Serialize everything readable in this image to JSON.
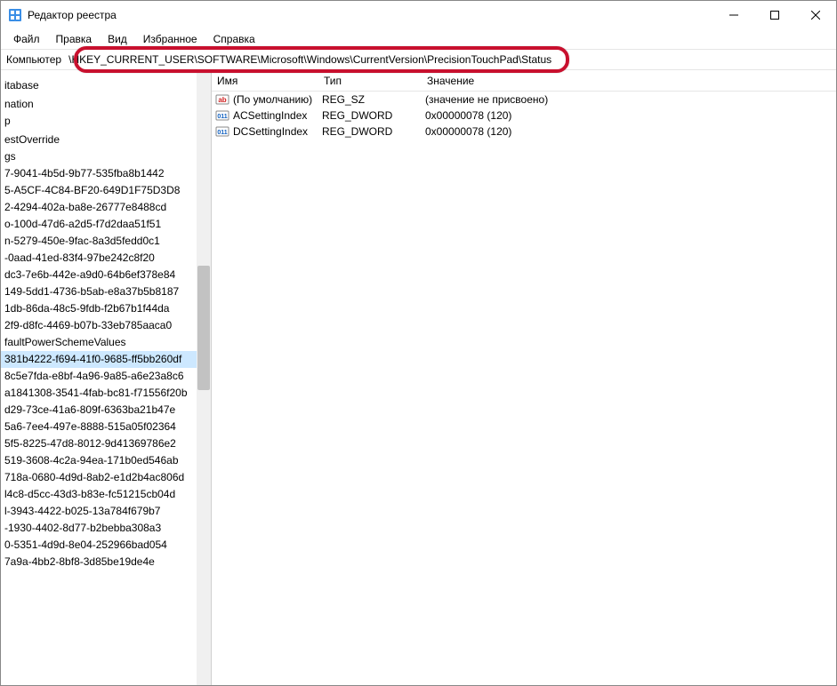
{
  "window": {
    "title": "Редактор реестра"
  },
  "menu": {
    "file": "Файл",
    "edit": "Правка",
    "view": "Вид",
    "favorites": "Избранное",
    "help": "Справка"
  },
  "addressbar": {
    "label": "Компьютер",
    "path": "\\HKEY_CURRENT_USER\\SOFTWARE\\Microsoft\\Windows\\CurrentVersion\\PrecisionTouchPad\\Status"
  },
  "tree": {
    "items": [
      "",
      "",
      "itabase",
      "",
      "nation",
      "p",
      "",
      "estOverride",
      "gs",
      "7-9041-4b5d-9b77-535fba8b1442",
      "5-A5CF-4C84-BF20-649D1F75D3D8",
      "2-4294-402a-ba8e-26777e8488cd",
      "o-100d-47d6-a2d5-f7d2daa51f51",
      "n-5279-450e-9fac-8a3d5fedd0c1",
      "-0aad-41ed-83f4-97be242c8f20",
      "dc3-7e6b-442e-a9d0-64b6ef378e84",
      "149-5dd1-4736-b5ab-e8a37b5b8187",
      "1db-86da-48c5-9fdb-f2b67b1f44da",
      "2f9-d8fc-4469-b07b-33eb785aaca0",
      "faultPowerSchemeValues",
      "381b4222-f694-41f0-9685-ff5bb260df",
      "8c5e7fda-e8bf-4a96-9a85-a6e23a8c6",
      "a1841308-3541-4fab-bc81-f71556f20b",
      "d29-73ce-41a6-809f-6363ba21b47e",
      "5a6-7ee4-497e-8888-515a05f02364",
      "5f5-8225-47d8-8012-9d41369786e2",
      "519-3608-4c2a-94ea-171b0ed546ab",
      "718a-0680-4d9d-8ab2-e1d2b4ac806d",
      "l4c8-d5cc-43d3-b83e-fc51215cb04d",
      "l-3943-4422-b025-13a784f679b7",
      "-1930-4402-8d77-b2bebba308a3",
      "0-5351-4d9d-8e04-252966bad054",
      "7a9a-4bb2-8bf8-3d85be19de4e"
    ],
    "selected_index": 20
  },
  "columns": {
    "name": "Имя",
    "type": "Тип",
    "value": "Значение"
  },
  "values": [
    {
      "icon": "ab",
      "name": "(По умолчанию)",
      "type": "REG_SZ",
      "data": "(значение не присвоено)"
    },
    {
      "icon": "bin",
      "name": "ACSettingIndex",
      "type": "REG_DWORD",
      "data": "0x00000078 (120)"
    },
    {
      "icon": "bin",
      "name": "DCSettingIndex",
      "type": "REG_DWORD",
      "data": "0x00000078 (120)"
    }
  ]
}
